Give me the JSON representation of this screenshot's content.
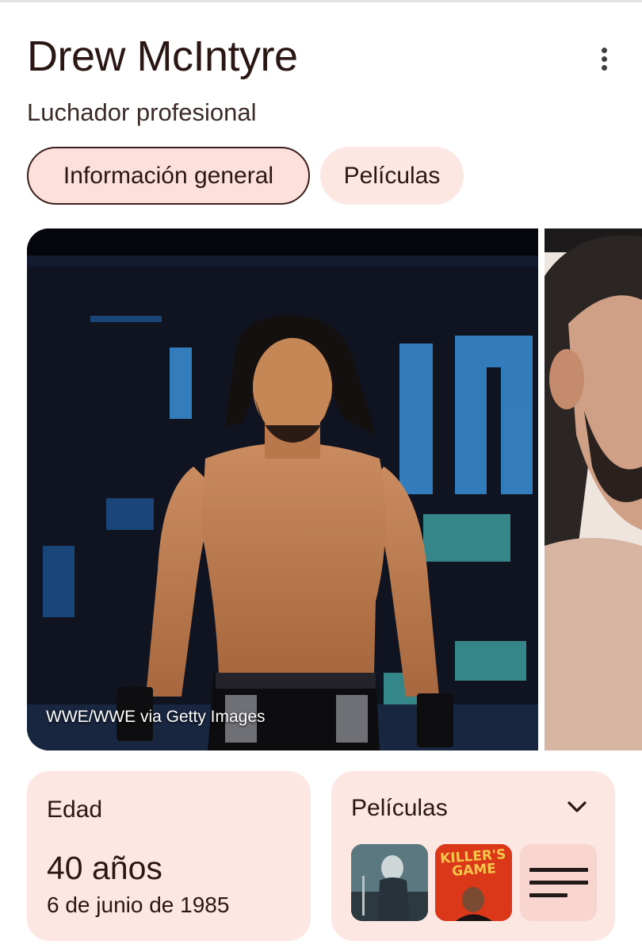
{
  "entity": {
    "name": "Drew McIntyre",
    "description": "Luchador profesional"
  },
  "tabs": [
    {
      "label": "Información general",
      "active": true
    },
    {
      "label": "Películas",
      "active": false
    }
  ],
  "gallery": {
    "main_credit": "WWE/WWE via Getty Images"
  },
  "age_card": {
    "label": "Edad",
    "value": "40 años",
    "birth_date": "6 de junio de 1985"
  },
  "films_card": {
    "label": "Películas",
    "thumb_2_title": "KILLER'S GAME"
  },
  "icons": {
    "menu": "more-vert-icon",
    "expand": "chevron-down-icon",
    "more_films": "list-icon"
  },
  "colors": {
    "chip_active_bg": "#fde0dc",
    "chip_bg": "#fde7e3",
    "card_bg": "#fde7e3",
    "text": "#2a1714"
  }
}
